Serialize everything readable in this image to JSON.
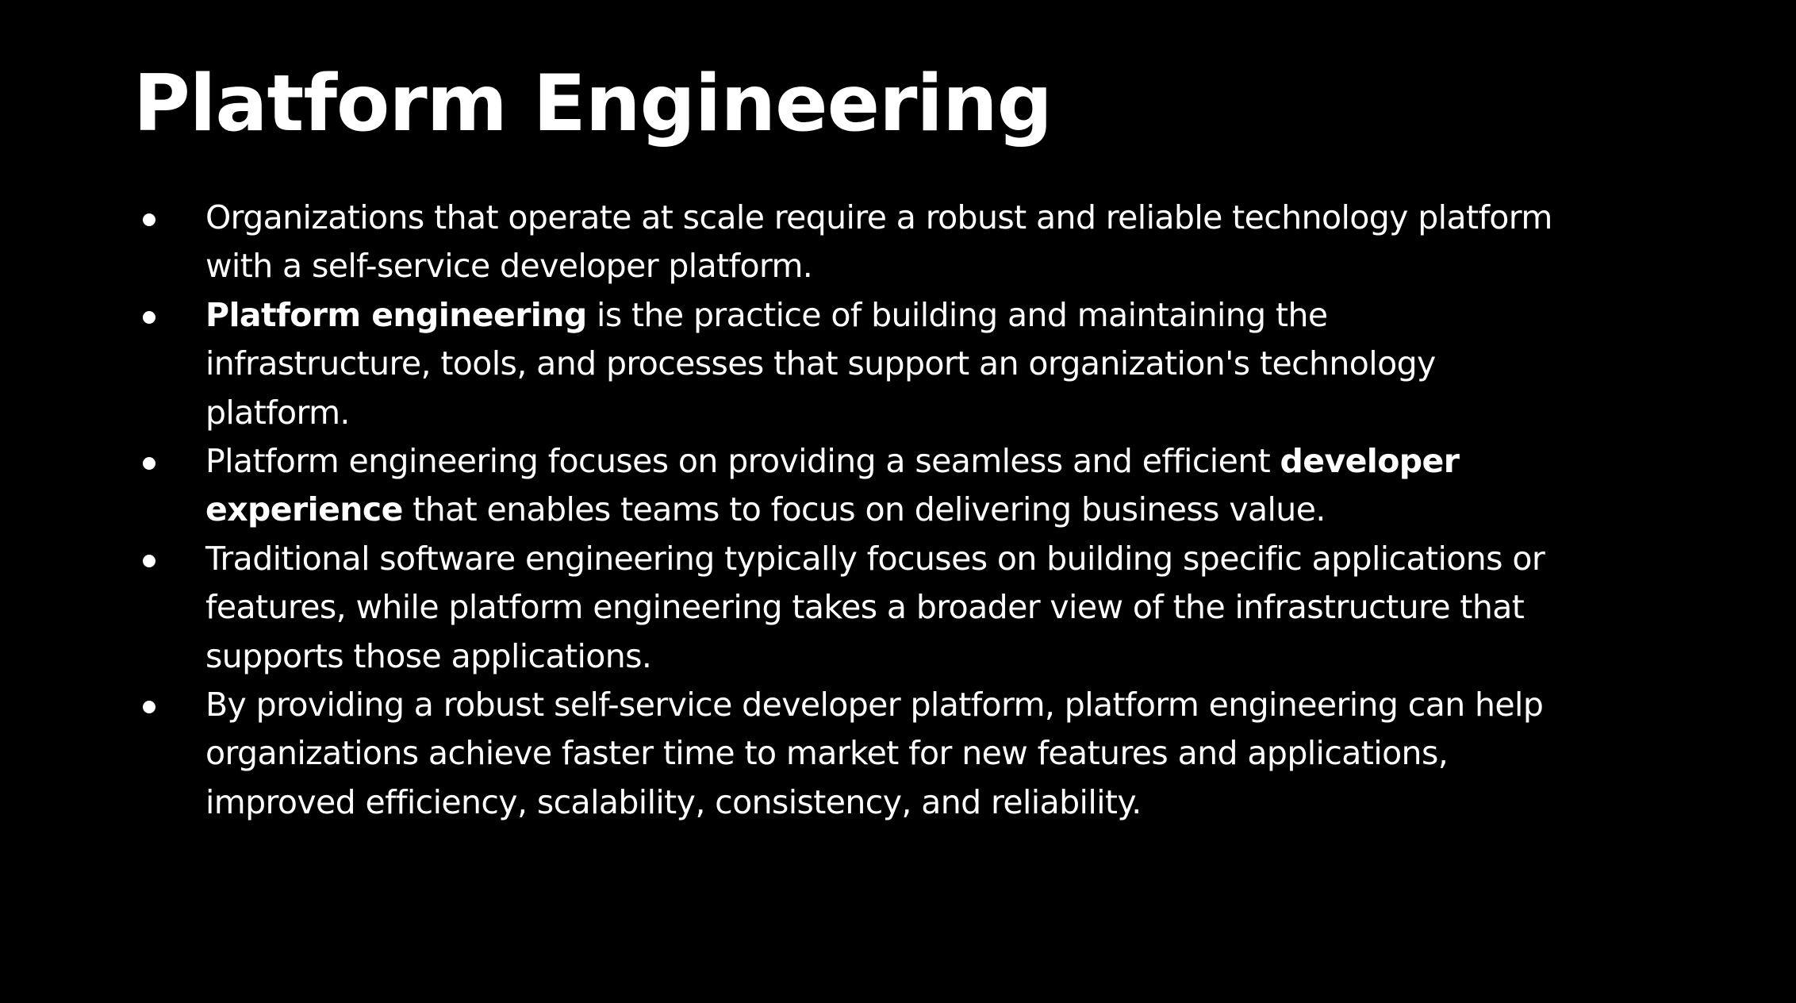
{
  "slide": {
    "title": "Platform Engineering",
    "bullets": [
      {
        "parts": [
          {
            "text": "Organizations that operate at scale require a robust and reliable technology platform with a self-service developer platform.",
            "bold": false
          }
        ]
      },
      {
        "parts": [
          {
            "text": "Platform engineering",
            "bold": true
          },
          {
            "text": " is the practice of building and maintaining the infrastructure, tools, and processes that support an organization's technology platform.",
            "bold": false
          }
        ]
      },
      {
        "parts": [
          {
            "text": "Platform engineering focuses on providing a seamless and efficient ",
            "bold": false
          },
          {
            "text": "developer experience",
            "bold": true
          },
          {
            "text": " that enables teams to focus on delivering business value.",
            "bold": false
          }
        ]
      },
      {
        "parts": [
          {
            "text": "Traditional software engineering typically focuses on building specific applications or features, while platform engineering takes a broader view of the infrastructure that supports those applications.",
            "bold": false
          }
        ]
      },
      {
        "parts": [
          {
            "text": "By providing a robust self-service developer platform, platform engineering can help organizations achieve faster time to market for new features and applications, improved efficiency, scalability, consistency, and reliability.",
            "bold": false
          }
        ]
      }
    ]
  },
  "colors": {
    "background": "#000000",
    "text": "#ffffff"
  }
}
